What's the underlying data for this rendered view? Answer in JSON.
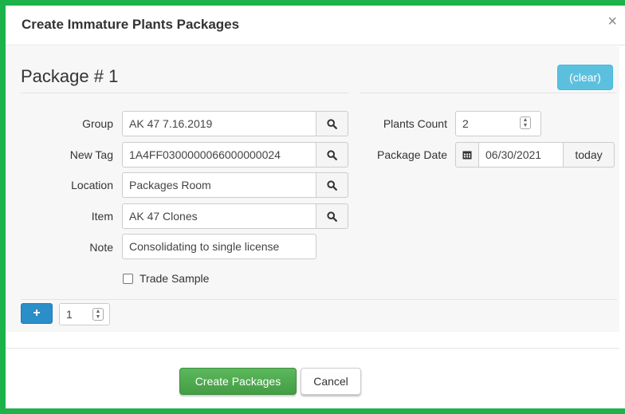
{
  "modal": {
    "title": "Create Immature Plants Packages",
    "close_symbol": "×"
  },
  "package": {
    "heading": "Package # 1",
    "clear_label": "(clear)"
  },
  "form": {
    "group_label": "Group",
    "group_value": "AK 47 7.16.2019",
    "new_tag_label": "New Tag",
    "new_tag_value": "1A4FF0300000066000000024",
    "location_label": "Location",
    "location_value": "Packages Room",
    "item_label": "Item",
    "item_value": "AK 47 Clones",
    "note_label": "Note",
    "note_value": "Consolidating to single license",
    "trade_sample_label": "Trade Sample",
    "trade_sample_checked": false,
    "plants_count_label": "Plants Count",
    "plants_count_value": "2",
    "package_date_label": "Package Date",
    "package_date_value": "06/30/2021",
    "today_label": "today"
  },
  "add_row": {
    "add_symbol": "+",
    "count_value": "1"
  },
  "footer": {
    "create_label": "Create Packages",
    "cancel_label": "Cancel"
  },
  "icons": {
    "search": "search-icon",
    "calendar": "calendar-icon",
    "plus": "plus-icon",
    "spinner": "spinner-icon"
  },
  "colors": {
    "frame_border": "#1db24a",
    "clear_button": "#5bc0de",
    "add_button": "#2a8ec9",
    "create_button": "#5cb85c"
  }
}
